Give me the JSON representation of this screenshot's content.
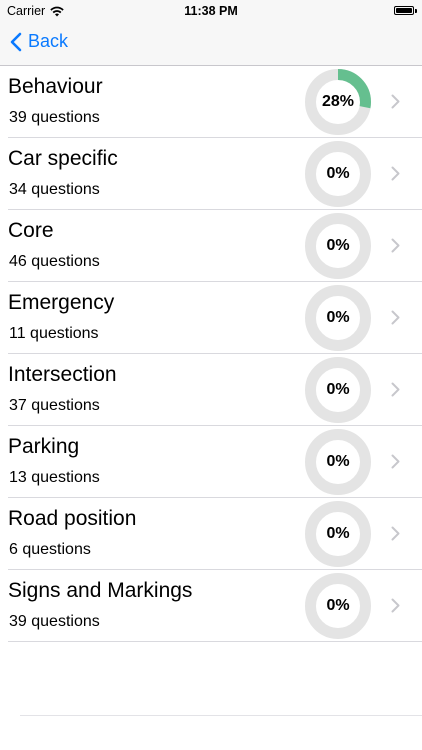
{
  "status_bar": {
    "carrier": "Carrier",
    "time": "11:38 PM"
  },
  "nav": {
    "back_label": "Back"
  },
  "colors": {
    "accent": "#0a7aff",
    "progress": "#65bf8f",
    "track": "#e4e4e4"
  },
  "categories": [
    {
      "title": "Behaviour",
      "subtitle": "39 questions",
      "percent_label": "28%",
      "progress": 0.28
    },
    {
      "title": "Car specific",
      "subtitle": "34 questions",
      "percent_label": "0%",
      "progress": 0
    },
    {
      "title": "Core",
      "subtitle": "46 questions",
      "percent_label": "0%",
      "progress": 0
    },
    {
      "title": "Emergency",
      "subtitle": "11 questions",
      "percent_label": "0%",
      "progress": 0
    },
    {
      "title": "Intersection",
      "subtitle": "37 questions",
      "percent_label": "0%",
      "progress": 0
    },
    {
      "title": "Parking",
      "subtitle": "13 questions",
      "percent_label": "0%",
      "progress": 0
    },
    {
      "title": "Road position",
      "subtitle": "6 questions",
      "percent_label": "0%",
      "progress": 0
    },
    {
      "title": "Signs and Markings",
      "subtitle": "39 questions",
      "percent_label": "0%",
      "progress": 0
    }
  ]
}
